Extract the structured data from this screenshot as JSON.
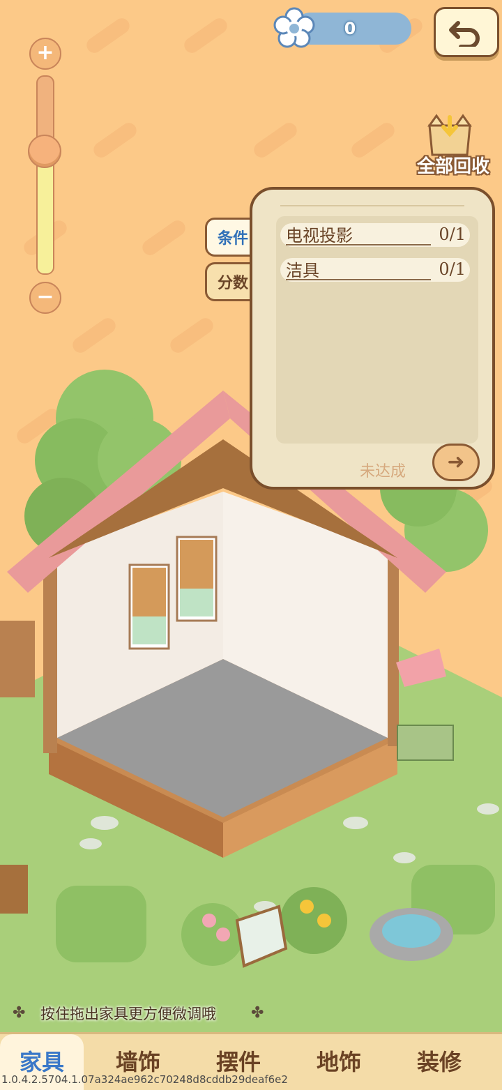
{
  "currency": {
    "value": "0",
    "icon": "flower-icon"
  },
  "back": {
    "icon": "back-arrow-icon"
  },
  "zoom": {
    "plus": "+",
    "minus": "−",
    "level": 0.62
  },
  "recycle": {
    "label": "全部回收",
    "icon": "box-icon"
  },
  "panel": {
    "tabs": [
      {
        "label": "条件",
        "active": true
      },
      {
        "label": "分数",
        "active": false
      }
    ],
    "conditions": [
      {
        "name": "电视投影",
        "count": "0/1"
      },
      {
        "name": "洁具",
        "count": "0/1"
      }
    ],
    "status": "未达成",
    "next_icon": "arrow-right-icon"
  },
  "hint": {
    "text": "按住拖出家具更方便微调哦"
  },
  "nav": {
    "items": [
      {
        "label": "家具",
        "active": true
      },
      {
        "label": "墙饰",
        "active": false
      },
      {
        "label": "摆件",
        "active": false
      },
      {
        "label": "地饰",
        "active": false
      },
      {
        "label": "装修",
        "active": false
      }
    ]
  },
  "version": "1.0.4.2.5704.1.07a324ae962c70248d8cddb29deaf6e2",
  "colors": {
    "background": "#fcc988",
    "accent_blue": "#3a78c8",
    "brown": "#7a4f2c",
    "grass": "#a9cf7a"
  }
}
